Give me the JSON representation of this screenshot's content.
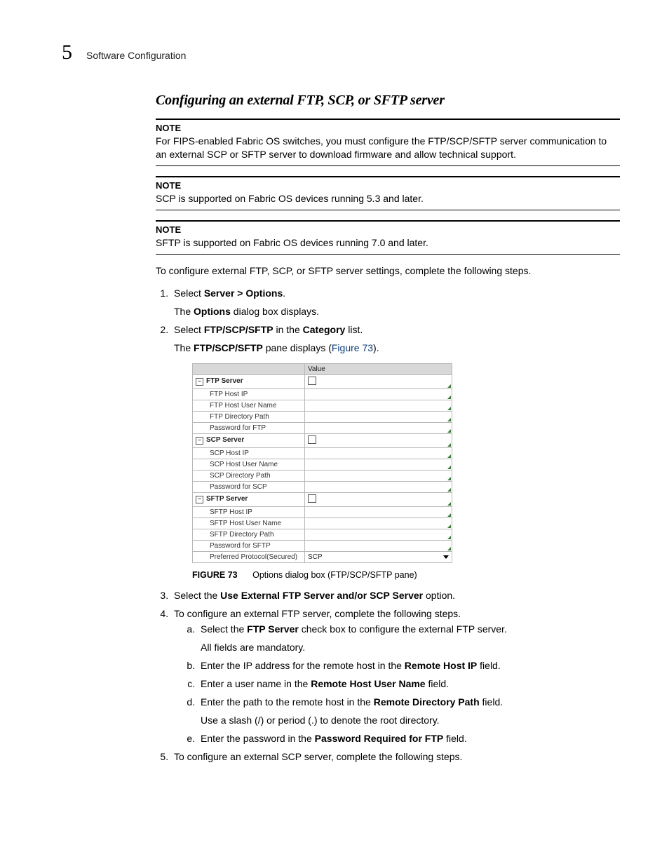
{
  "header": {
    "chapter_number": "5",
    "chapter_title": "Software Configuration"
  },
  "section": {
    "title": "Configuring an external FTP, SCP, or SFTP server"
  },
  "notes": [
    {
      "label": "NOTE",
      "text": "For FIPS-enabled Fabric OS switches, you must configure the FTP/SCP/SFTP server communication to an external SCP or SFTP server to download firmware and allow technical support."
    },
    {
      "label": "NOTE",
      "text": "SCP is supported on Fabric OS devices running 5.3 and later."
    },
    {
      "label": "NOTE",
      "text": "SFTP is supported on Fabric OS devices running 7.0 and later."
    }
  ],
  "intro_para": "To configure external FTP, SCP, or SFTP server settings, complete the following steps.",
  "steps": {
    "s1_prefix": "Select ",
    "s1_bold": "Server > Options",
    "s1_suffix": ".",
    "s1_sub_prefix": "The ",
    "s1_sub_bold": "Options",
    "s1_sub_suffix": " dialog box displays.",
    "s2_prefix": "Select ",
    "s2_bold1": "FTP/SCP/SFTP",
    "s2_mid": " in the ",
    "s2_bold2": "Category",
    "s2_suffix": " list.",
    "s2_sub_prefix": "The ",
    "s2_sub_bold": "FTP/SCP/SFTP",
    "s2_sub_mid": " pane displays (",
    "s2_sub_link": "Figure 73",
    "s2_sub_suffix": ").",
    "s3_prefix": "Select the ",
    "s3_bold": "Use External FTP Server and/or SCP Server",
    "s3_suffix": " option.",
    "s4_text": "To configure an external FTP server, complete the following steps.",
    "s4a_prefix": "Select the ",
    "s4a_bold": "FTP Server",
    "s4a_suffix": " check box to configure the external FTP server.",
    "s4a_sub": "All fields are mandatory.",
    "s4b_prefix": "Enter the IP address for the remote host in the ",
    "s4b_bold": "Remote Host IP",
    "s4b_suffix": " field.",
    "s4c_prefix": "Enter a user name in the ",
    "s4c_bold": "Remote Host User Name",
    "s4c_suffix": " field.",
    "s4d_prefix": "Enter the path to the remote host in the ",
    "s4d_bold": "Remote Directory Path",
    "s4d_suffix": " field.",
    "s4d_sub": "Use a slash (/) or period (.) to denote the root directory.",
    "s4e_prefix": "Enter the password in the ",
    "s4e_bold": "Password Required for FTP",
    "s4e_suffix": " field.",
    "s5_text": "To configure an external SCP server, complete the following steps."
  },
  "figure": {
    "label": "FIGURE 73",
    "caption": "Options dialog box (FTP/SCP/SFTP pane)",
    "header_value": "Value",
    "groups": [
      {
        "name": "FTP Server",
        "children": [
          "FTP Host IP",
          "FTP Host User Name",
          "FTP Directory Path",
          "Password for FTP"
        ]
      },
      {
        "name": "SCP Server",
        "children": [
          "SCP Host IP",
          "SCP Host User Name",
          "SCP Directory Path",
          "Password for SCP"
        ]
      },
      {
        "name": "SFTP Server",
        "children": [
          "SFTP Host IP",
          "SFTP Host User Name",
          "SFTP Directory Path",
          "Password for SFTP"
        ]
      }
    ],
    "last_row_label": "Preferred Protocol(Secured)",
    "last_row_value": "SCP"
  }
}
